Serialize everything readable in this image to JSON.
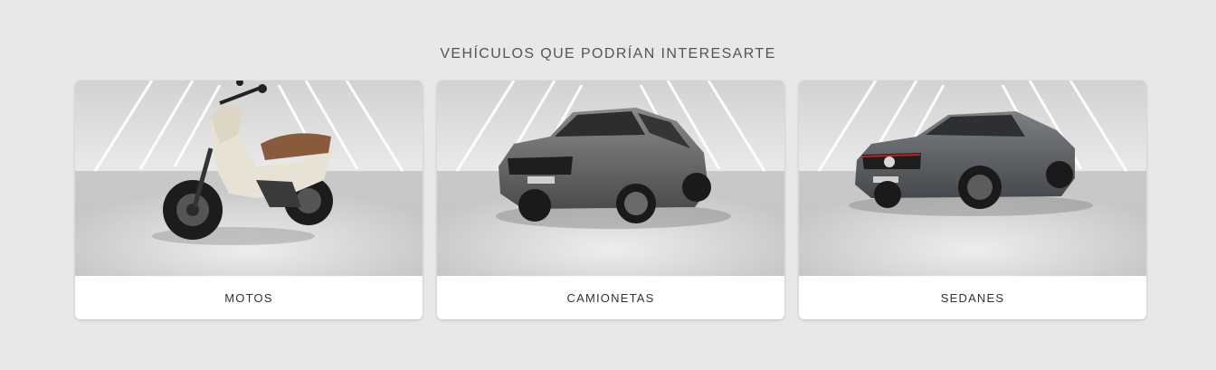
{
  "section": {
    "title": "VEHÍCULOS QUE PODRÍAN INTERESARTE"
  },
  "cards": [
    {
      "label": "MOTOS",
      "image": "motorcycle-image"
    },
    {
      "label": "CAMIONETAS",
      "image": "suv-image"
    },
    {
      "label": "SEDANES",
      "image": "sedan-image"
    }
  ],
  "colors": {
    "background": "#e8e8e8",
    "card": "#ffffff",
    "title_text": "#555555",
    "label_text": "#333333"
  }
}
